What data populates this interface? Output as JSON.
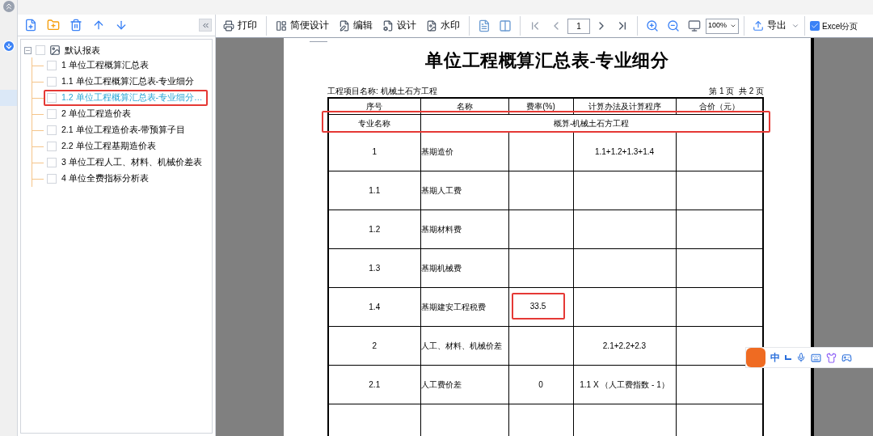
{
  "tree": {
    "label": "默认报表",
    "expanded": true,
    "checked": false,
    "children": [
      {
        "label": "1 单位工程概算汇总表",
        "checked": false,
        "selected": false,
        "highlighted": false
      },
      {
        "label": "1.1 单位工程概算汇总表-专业细分",
        "checked": false,
        "selected": false,
        "highlighted": false
      },
      {
        "label": "1.2 单位工程概算汇总表-专业细分…",
        "checked": false,
        "selected": true,
        "highlighted": true
      },
      {
        "label": "2 单位工程造价表",
        "checked": false,
        "selected": false,
        "highlighted": false
      },
      {
        "label": "2.1 单位工程造价表-带预算子目",
        "checked": false,
        "selected": false,
        "highlighted": false
      },
      {
        "label": "2.2 单位工程基期造价表",
        "checked": false,
        "selected": false,
        "highlighted": false
      },
      {
        "label": "3 单位工程人工、材料、机械价差表",
        "checked": false,
        "selected": false,
        "highlighted": false
      },
      {
        "label": "4 单位全费指标分析表",
        "checked": false,
        "selected": false,
        "highlighted": false
      }
    ]
  },
  "toolbar": {
    "buttons": [
      {
        "kind": "print",
        "label": "打印"
      },
      {
        "kind": "simple-design",
        "label": "简便设计"
      },
      {
        "kind": "edit",
        "label": "编辑"
      },
      {
        "kind": "design",
        "label": "设计"
      },
      {
        "kind": "watermark",
        "label": "水印"
      }
    ],
    "page": "1",
    "zoom": "100%",
    "export": "导出",
    "excel_split": {
      "label": "Excel分页",
      "checked": true
    }
  },
  "report": {
    "title": "单位工程概算汇总表-专业细分",
    "project": "工程项目名称: 机械土石方工程",
    "page_info": "第 1 页  共 2 页",
    "columns": [
      "序号",
      "名称",
      "费率(%)",
      "计算办法及计算程序",
      "合价（元）"
    ],
    "specialty": {
      "label": "专业名称",
      "value": "概算-机械土石方工程",
      "highlighted": true
    },
    "rows": [
      {
        "no": "1",
        "name": "基期造价",
        "rate": "",
        "method": "1.1+1.2+1.3+1.4",
        "highlighted": false
      },
      {
        "no": "1.1",
        "name": "基期人工费",
        "rate": "",
        "method": "",
        "highlighted": false
      },
      {
        "no": "1.2",
        "name": "基期材料费",
        "rate": "",
        "method": "",
        "highlighted": false
      },
      {
        "no": "1.3",
        "name": "基期机械费",
        "rate": "",
        "method": "",
        "highlighted": false
      },
      {
        "no": "1.4",
        "name": "基期建安工程税费",
        "rate": "33.5",
        "method": "",
        "highlighted": true
      },
      {
        "no": "2",
        "name": "人工、材料、机械价差",
        "rate": "",
        "method": "2.1+2.2+2.3",
        "highlighted": false
      },
      {
        "no": "2.1",
        "name": "人工费价差",
        "rate": "0",
        "method": "1.1 X （人工费指数 - 1）",
        "highlighted": false
      }
    ]
  },
  "ime": {
    "label": "中"
  }
}
